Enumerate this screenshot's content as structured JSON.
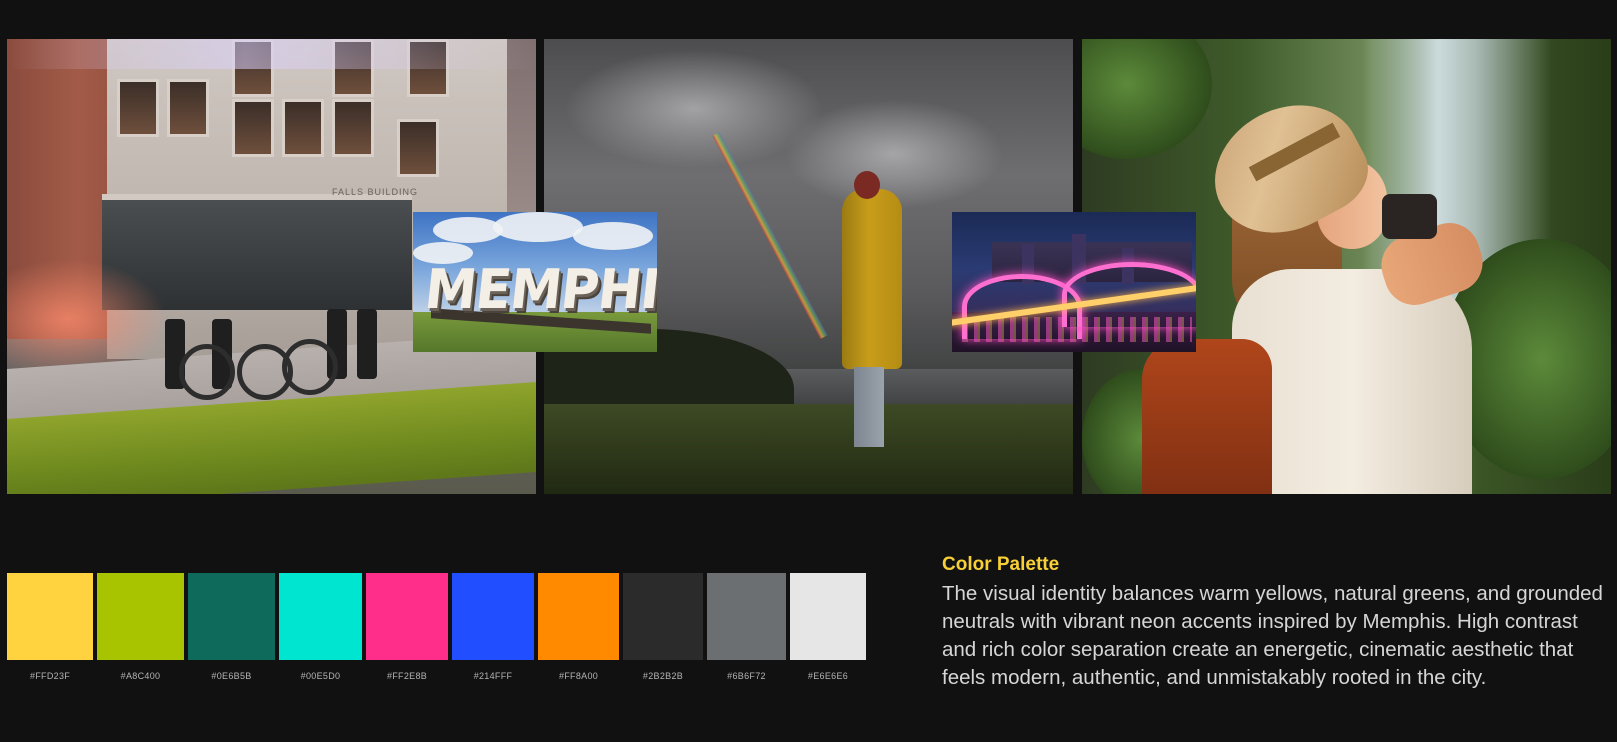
{
  "photos": {
    "photo1": {
      "building_sign": "FALLS BUILDING"
    },
    "overlay_memphis": {
      "sign_text": "MEMPHIS"
    }
  },
  "palette": {
    "swatches": [
      {
        "hex": "#FFD23F",
        "color": "#FFD23F"
      },
      {
        "hex": "#A8C400",
        "color": "#A8C400"
      },
      {
        "hex": "#0E6B5B",
        "color": "#0E6B5B"
      },
      {
        "hex": "#00E5D0",
        "color": "#00E5D0"
      },
      {
        "hex": "#FF2E8B",
        "color": "#FF2E8B"
      },
      {
        "hex": "#214FFF",
        "color": "#214FFF"
      },
      {
        "hex": "#FF8A00",
        "color": "#FF8A00"
      },
      {
        "hex": "#2B2B2B",
        "color": "#2B2B2B"
      },
      {
        "hex": "#6B6F72",
        "color": "#6B6F72"
      },
      {
        "hex": "#E6E6E6",
        "color": "#E6E6E6"
      }
    ]
  },
  "description": {
    "title": "Color Palette",
    "body": "The visual identity balances warm yellows, natural greens, and grounded neutrals with vibrant neon accents inspired by Memphis. High contrast and rich color separation create an energetic, cinematic aesthetic that feels modern, authentic, and unmistakably rooted in the city."
  }
}
